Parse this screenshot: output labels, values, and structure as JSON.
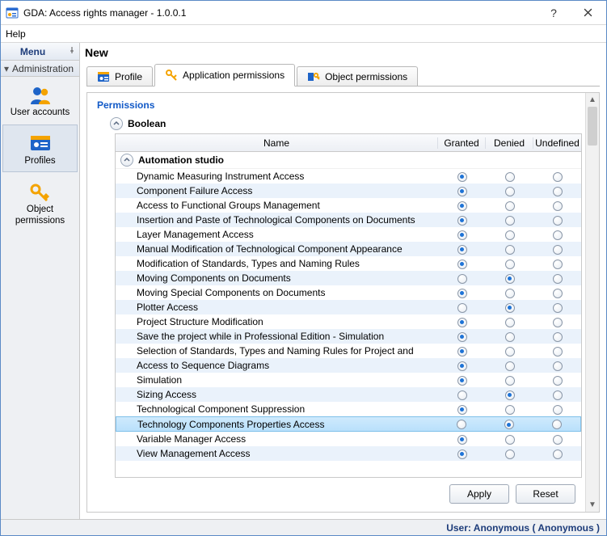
{
  "window": {
    "title": "GDA: Access rights manager - 1.0.0.1"
  },
  "menu": {
    "help": "Help",
    "label": "Menu",
    "section": "Administration",
    "items": [
      {
        "label": "User accounts"
      },
      {
        "label": "Profiles"
      },
      {
        "label": "Object permissions"
      }
    ]
  },
  "page": {
    "title": "New"
  },
  "tabs": [
    {
      "label": "Profile"
    },
    {
      "label": "Application permissions"
    },
    {
      "label": "Object permissions"
    }
  ],
  "perm": {
    "heading": "Permissions",
    "group": "Boolean",
    "subgroup": "Automation studio",
    "columns": {
      "name": "Name",
      "granted": "Granted",
      "denied": "Denied",
      "undef": "Undefined"
    },
    "rows": [
      {
        "name": "Dynamic Measuring Instrument Access",
        "state": "granted",
        "alt": false,
        "sel": false
      },
      {
        "name": "Component Failure Access",
        "state": "granted",
        "alt": true,
        "sel": false
      },
      {
        "name": "Access to Functional Groups Management",
        "state": "granted",
        "alt": false,
        "sel": false
      },
      {
        "name": "Insertion and Paste of Technological Components on Documents",
        "state": "granted",
        "alt": true,
        "sel": false
      },
      {
        "name": "Layer Management Access",
        "state": "granted",
        "alt": false,
        "sel": false
      },
      {
        "name": "Manual Modification of Technological Component Appearance",
        "state": "granted",
        "alt": true,
        "sel": false
      },
      {
        "name": "Modification of Standards, Types and Naming Rules",
        "state": "granted",
        "alt": false,
        "sel": false
      },
      {
        "name": "Moving Components on Documents",
        "state": "denied",
        "alt": true,
        "sel": false
      },
      {
        "name": "Moving Special Components on Documents",
        "state": "granted",
        "alt": false,
        "sel": false
      },
      {
        "name": "Plotter Access",
        "state": "denied",
        "alt": true,
        "sel": false
      },
      {
        "name": "Project Structure Modification",
        "state": "granted",
        "alt": false,
        "sel": false
      },
      {
        "name": "Save the project while in Professional Edition - Simulation",
        "state": "granted",
        "alt": true,
        "sel": false
      },
      {
        "name": "Selection of Standards, Types and Naming Rules for Project and ",
        "state": "granted",
        "alt": false,
        "sel": false
      },
      {
        "name": "Access to Sequence Diagrams",
        "state": "granted",
        "alt": true,
        "sel": false
      },
      {
        "name": "Simulation",
        "state": "granted",
        "alt": false,
        "sel": false
      },
      {
        "name": "Sizing Access",
        "state": "denied",
        "alt": true,
        "sel": false
      },
      {
        "name": "Technological Component Suppression",
        "state": "granted",
        "alt": false,
        "sel": false
      },
      {
        "name": "Technology Components Properties Access",
        "state": "denied",
        "alt": true,
        "sel": true
      },
      {
        "name": "Variable Manager Access",
        "state": "granted",
        "alt": false,
        "sel": false
      },
      {
        "name": "View Management Access",
        "state": "granted",
        "alt": true,
        "sel": false
      }
    ]
  },
  "buttons": {
    "apply": "Apply",
    "reset": "Reset"
  },
  "status": "User: Anonymous ( Anonymous )"
}
